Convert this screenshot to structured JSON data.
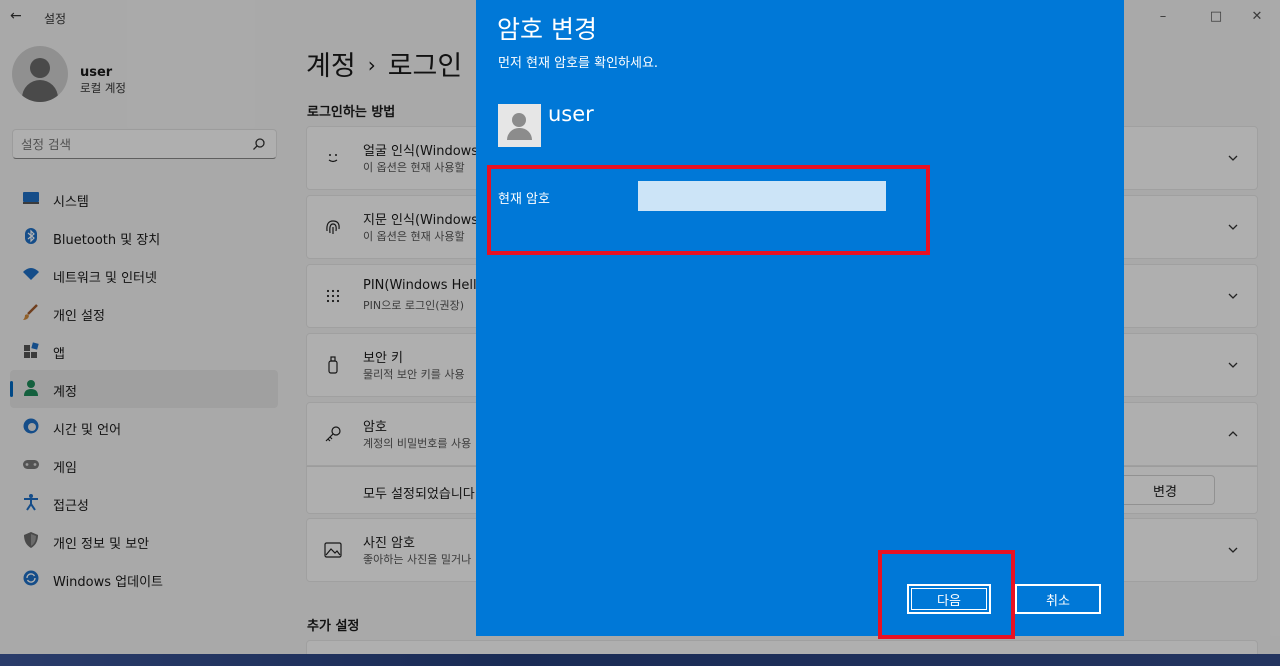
{
  "window": {
    "app_title": "설정",
    "back_icon": "back-arrow-icon",
    "controls": [
      "minimize-icon",
      "maximize-icon",
      "close-icon"
    ]
  },
  "profile": {
    "name": "user",
    "type": "로컬 계정"
  },
  "search": {
    "placeholder": "설정 검색"
  },
  "sidebar": {
    "items": [
      {
        "label": "시스템",
        "icon": "system-icon"
      },
      {
        "label": "Bluetooth 및 장치",
        "icon": "bluetooth-icon"
      },
      {
        "label": "네트워크 및 인터넷",
        "icon": "network-icon"
      },
      {
        "label": "개인 설정",
        "icon": "brush-icon"
      },
      {
        "label": "앱",
        "icon": "apps-icon"
      },
      {
        "label": "계정",
        "icon": "account-icon",
        "active": true
      },
      {
        "label": "시간 및 언어",
        "icon": "time-language-icon"
      },
      {
        "label": "게임",
        "icon": "gamepad-icon"
      },
      {
        "label": "접근성",
        "icon": "accessibility-icon"
      },
      {
        "label": "개인 정보 및 보안",
        "icon": "shield-icon"
      },
      {
        "label": "Windows 업데이트",
        "icon": "update-icon"
      }
    ]
  },
  "main": {
    "breadcrumb": {
      "parent": "계정",
      "separator": "›",
      "current": "로그인"
    },
    "section_signin": "로그인하는 방법",
    "section_more": "추가 설정",
    "cards": [
      {
        "title": "얼굴 인식(Windows",
        "sub": "이 옵션은 현재 사용할",
        "icon": "face-icon"
      },
      {
        "title": "지문 인식(Windows",
        "sub": "이 옵션은 현재 사용할",
        "icon": "fingerprint-icon"
      },
      {
        "title": "PIN(Windows Hello",
        "sub": "PIN으로 로그인(권장)",
        "icon": "pin-keypad-icon"
      },
      {
        "title": "보안 키",
        "sub": "물리적 보안 키를 사용",
        "icon": "usb-key-icon"
      },
      {
        "title": "암호",
        "sub": "계정의 비밀번호를 사용",
        "icon": "key-icon"
      },
      {
        "title": "사진 암호",
        "sub": "좋아하는 사진을 밀거나",
        "icon": "picture-icon"
      }
    ],
    "password_detail": {
      "text": "모두 설정되었습니다",
      "button": "변경"
    }
  },
  "dialog": {
    "title": "암호 변경",
    "subtitle": "먼저 현재 암호를 확인하세요.",
    "user": "user",
    "field_label": "현재 암호",
    "field_value": "",
    "next_button": "다음",
    "cancel_button": "취소"
  },
  "colors": {
    "dialog_bg": "#0078d7",
    "input_bg": "#cce4f7",
    "annotation": "#e81123",
    "accent": "#0067c0"
  }
}
